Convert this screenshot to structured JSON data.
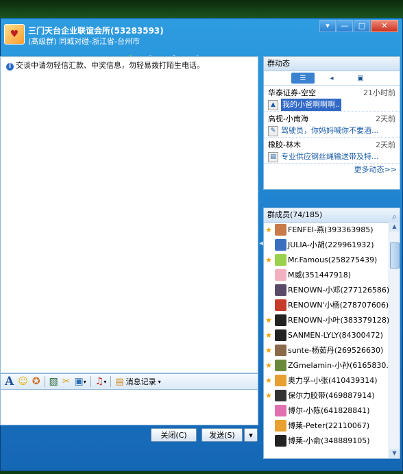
{
  "window": {
    "title": "三门天台企业联谊会所(53283593)",
    "subtitle": "(高级群) 同城对碰-浙江省-台州市",
    "avatar_char": "♥",
    "controls": [
      "▾",
      "—",
      "□",
      "✕"
    ]
  },
  "toolbar": {
    "items": [
      {
        "name": "home-icon",
        "glyph": "⌂",
        "color": "#f2a33a",
        "dropdown": true
      },
      {
        "name": "folder-icon",
        "glyph": "▰",
        "color": "#f5b840",
        "dropdown": false
      },
      {
        "name": "album-icon",
        "glyph": "▥",
        "color": "#f0c060",
        "dropdown": false
      },
      {
        "name": "card-icon",
        "glyph": "▤",
        "color": "#dde8f4",
        "dropdown": false
      },
      {
        "name": "mail-icon",
        "glyph": "✉",
        "color": "#f6f1c4",
        "dropdown": false
      },
      {
        "name": "add-doc-icon",
        "glyph": "✚",
        "color": "#5fd35a",
        "dropdown": false
      },
      {
        "name": "tools-icon",
        "glyph": "✎",
        "color": "#e0e8f0",
        "dropdown": false
      },
      {
        "name": "admin-icon",
        "glyph": "♟",
        "color": "#f0f4ff",
        "dropdown": false
      },
      {
        "name": "settings-icon",
        "glyph": "⚙",
        "color": "#e8eef4",
        "dropdown": true
      }
    ]
  },
  "chat": {
    "notice_icon": "i",
    "notice": "交谈中请勿轻信汇款、中奖信息，勿轻易拨打陌生电话。"
  },
  "format_bar": {
    "font_glyph": "A",
    "emoji_glyph": "☺",
    "history_label": "消息记录"
  },
  "buttons": {
    "close": "关闭(C)",
    "send": "发送(S)",
    "send_menu": "▾"
  },
  "dynamics": {
    "header": "群动态",
    "tabs": [
      "☰",
      "◂",
      "▣"
    ],
    "items": [
      {
        "author": "华泰证券-空空",
        "time": "21小时前",
        "icon": "▲",
        "message": "我的小爸啊啊啊..",
        "highlighted": true
      },
      {
        "author": "高枧-小南海",
        "time": "2天前",
        "icon": "✎",
        "message": "驾驶员，你妈妈喊你不要酒...",
        "highlighted": false
      },
      {
        "author": "橡胶-林木",
        "time": "2天前",
        "icon": "▤",
        "message": "专业供应钢丝绳输送带及特...",
        "highlighted": false
      }
    ],
    "more": "更多动态>>"
  },
  "members": {
    "header": "群成员(74/185)",
    "search_icon": "⌕",
    "list": [
      {
        "admin": true,
        "color": "#c87a4a",
        "name": "FENFEI-燕(393363985)"
      },
      {
        "admin": false,
        "color": "#3a6fc0",
        "name": "JULIA-小胡(229961932)"
      },
      {
        "admin": true,
        "color": "#9ad04a",
        "name": "Mr.Famous(258275439)"
      },
      {
        "admin": false,
        "color": "#f3b0c0",
        "name": "M威(351447918)"
      },
      {
        "admin": false,
        "color": "#5a4a6a",
        "name": "RENOWN-小邓(277126586)"
      },
      {
        "admin": false,
        "color": "#c83a2a",
        "name": "RENOWN'小杨(278707606)"
      },
      {
        "admin": true,
        "color": "#222222",
        "name": "RENOWN-小叶(383379128)"
      },
      {
        "admin": true,
        "color": "#222222",
        "name": "SANMEN-LYLY(84300472)"
      },
      {
        "admin": true,
        "color": "#8a6a4a",
        "name": "sunte-杨茹丹(269526630)"
      },
      {
        "admin": true,
        "color": "#6a8a3a",
        "name": "ZGmelamin-小孙(6165830..."
      },
      {
        "admin": true,
        "color": "#e8a030",
        "name": "奥力孚-小张(410439314)"
      },
      {
        "admin": true,
        "color": "#333333",
        "name": "保尔力胶带(469887914)"
      },
      {
        "admin": false,
        "color": "#e070b0",
        "name": "博尔-小陈(641828841)"
      },
      {
        "admin": false,
        "color": "#e8a030",
        "name": "博莱-Peter(22110067)"
      },
      {
        "admin": false,
        "color": "#222222",
        "name": "博莱-小俞(348889105)"
      }
    ]
  }
}
